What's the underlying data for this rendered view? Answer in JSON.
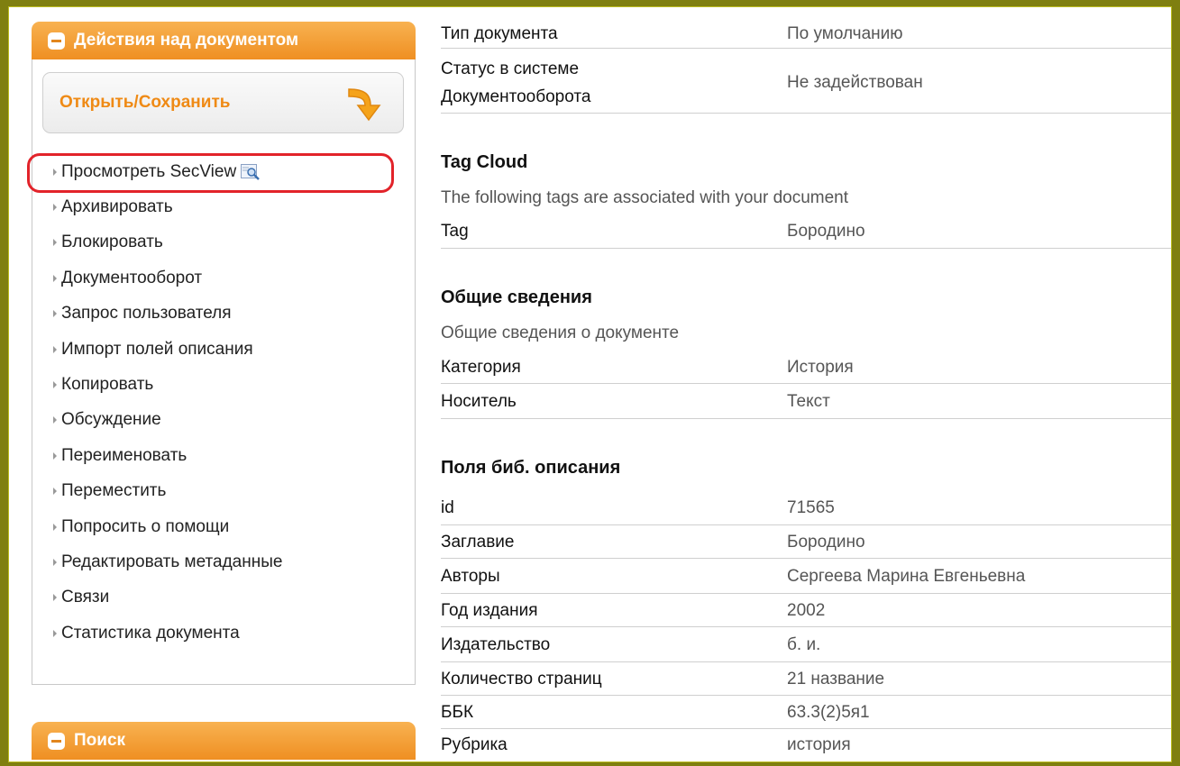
{
  "sidebar": {
    "actions_header": "Действия над документом",
    "open_save_label": "Открыть/Сохранить",
    "menu": [
      "Просмотреть SecView",
      "Архивировать",
      "Блокировать",
      "Документооборот",
      "Запрос пользователя",
      "Импорт полей описания",
      "Копировать",
      "Обсуждение",
      "Переименовать",
      "Переместить",
      "Попросить о помощи",
      "Редактировать метаданные",
      "Связи",
      "Статистика документа"
    ],
    "search_header": "Поиск"
  },
  "document": {
    "type_label": "Тип документа",
    "type_value": "По умолчанию",
    "status_label_1": "Статус в системе",
    "status_label_2": "Документооборота",
    "status_value": "Не задействован"
  },
  "tag_cloud": {
    "title": "Tag Cloud",
    "description": "The following tags are associated with your document",
    "tag_label": "Tag",
    "tag_value": "Бородино"
  },
  "general": {
    "title": "Общие сведения",
    "description": "Общие сведения о документе",
    "rows": [
      {
        "label": "Категория",
        "value": "История"
      },
      {
        "label": "Носитель",
        "value": "Текст"
      }
    ]
  },
  "bib": {
    "title": "Поля биб. описания",
    "rows": [
      {
        "label": "id",
        "value": "71565"
      },
      {
        "label": "Заглавие",
        "value": "Бородино"
      },
      {
        "label": "Авторы",
        "value": "Сергеева Марина Евгеньевна"
      },
      {
        "label": "Год издания",
        "value": "2002"
      },
      {
        "label": "Издательство",
        "value": "б. и."
      },
      {
        "label": "Количество страниц",
        "value": "21 название"
      },
      {
        "label": "ББК",
        "value": "63.3(2)5я1"
      },
      {
        "label": "Рубрика",
        "value": "история"
      }
    ]
  },
  "colors": {
    "frame": "#7f7f10",
    "accent_orange": "#ef8f22",
    "highlight_red": "#e2232a"
  },
  "icons": [
    "minus-icon",
    "arrow-down-right-icon",
    "magnifier-icon",
    "triangle-bullet-icon"
  ]
}
